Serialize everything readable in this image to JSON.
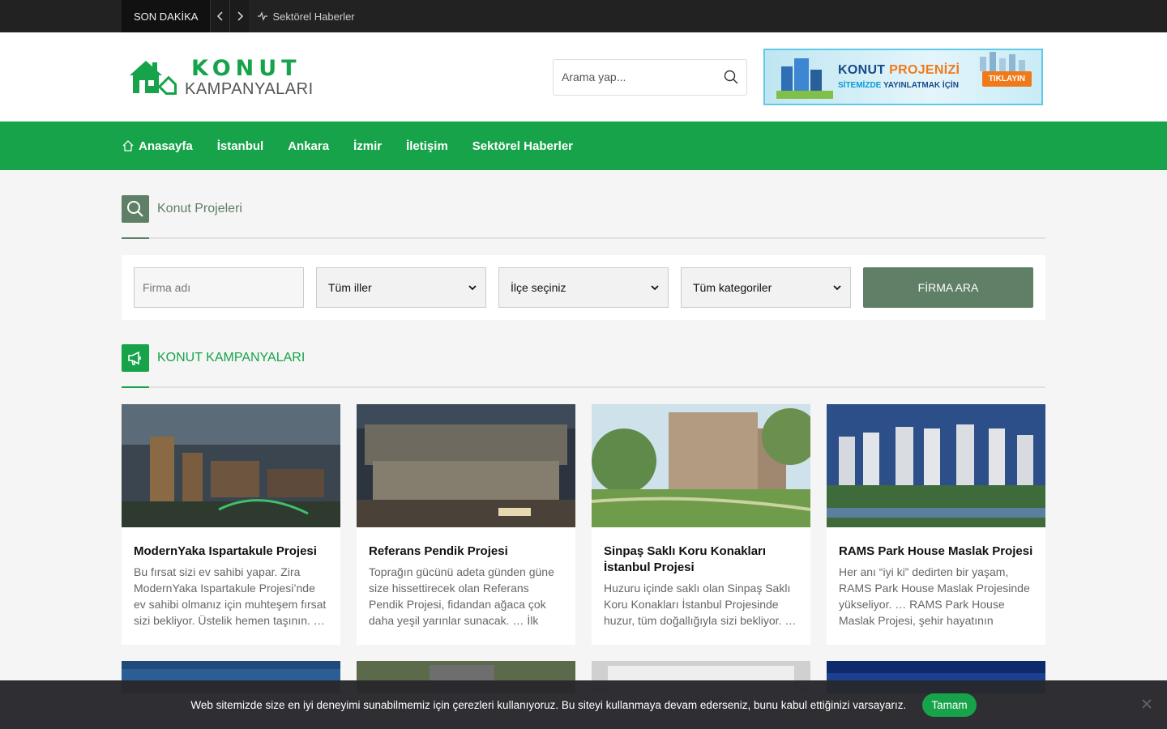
{
  "topbar": {
    "breaking_label": "SON DAKİKA",
    "ticker_text": "Sektörel Haberler"
  },
  "header": {
    "logo_top": "KONUT",
    "logo_bottom": "KAMPANYALARI",
    "search_placeholder": "Arama yap...",
    "banner": {
      "title_a": "KONUT ",
      "title_b": "PROJENİZİ",
      "sub_a": "SİTEMİZDE ",
      "sub_b": "YAYINLATMAK İÇİN",
      "button": "TIKLAYIN"
    }
  },
  "nav": {
    "items": [
      {
        "label": "Anasayfa"
      },
      {
        "label": "İstanbul"
      },
      {
        "label": "Ankara"
      },
      {
        "label": "İzmir"
      },
      {
        "label": "İletişim"
      },
      {
        "label": "Sektörel Haberler"
      }
    ]
  },
  "section1": {
    "title": "Konut Projeleri"
  },
  "filter": {
    "firm_placeholder": "Firma adı",
    "province": "Tüm iller",
    "district": "İlçe seçiniz",
    "category": "Tüm kategoriler",
    "button": "FİRMA ARA"
  },
  "section2": {
    "title": "KONUT KAMPANYALARI"
  },
  "cards": [
    {
      "title": "ModernYaka Ispartakule Projesi",
      "excerpt": "Bu fırsat sizi ev sahibi yapar. Zira ModernYaka Ispartakule Projesi’nde ev sahibi olmanız için muhteşem fırsat sizi bekliyor. Üstelik hemen taşının. …"
    },
    {
      "title": "Referans Pendik Projesi",
      "excerpt": "Toprağın gücünü adeta günden güne size hissettirecek olan Referans Pendik Projesi, fidandan ağaca çok daha yeşil yarınlar sunacak. … İlk"
    },
    {
      "title": "Sinpaş Saklı Koru Konakları İstanbul Projesi",
      "excerpt": "Huzuru içinde saklı olan Sinpaş Saklı Koru Konakları İstanbul Projesinde huzur, tüm doğallığıyla sizi bekliyor. …"
    },
    {
      "title": "RAMS Park House Maslak Projesi",
      "excerpt": "Her anı “iyi ki” dedirten bir yaşam, RAMS Park House Maslak Projesinde yükseliyor. … RAMS Park House Maslak Projesi, şehir hayatının"
    }
  ],
  "cookie": {
    "message": "Web sitemizde size en iyi deneyimi sunabilmemiz için çerezleri kullanıyoruz. Bu siteyi kullanmaya devam ederseniz, bunu kabul ettiğinizi varsayarız.",
    "accept": "Tamam"
  },
  "colors": {
    "brand_green": "#16a34a",
    "muted_green": "#5f7f67",
    "topbar": "#222222"
  }
}
